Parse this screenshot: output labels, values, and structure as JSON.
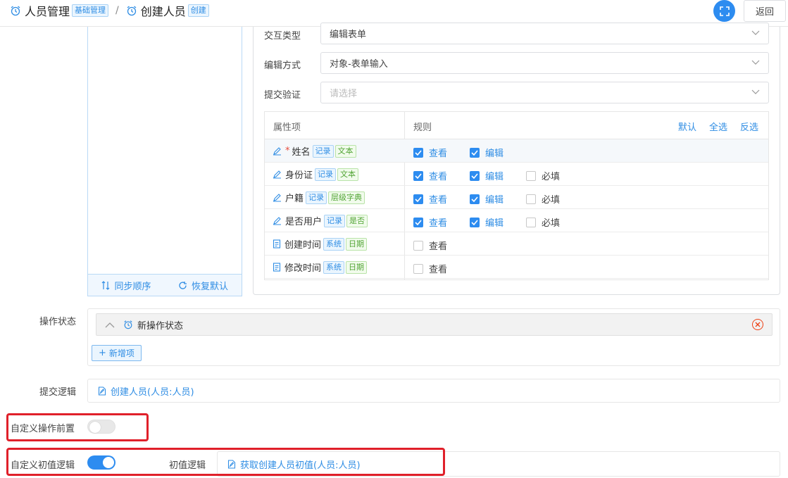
{
  "header": {
    "crumb1_title": "人员管理",
    "crumb1_badge": "基础管理",
    "separator": "/",
    "crumb2_title": "创建人员",
    "crumb2_badge": "创建",
    "back_label": "返回"
  },
  "left_panel": {
    "sync_label": "同步顺序",
    "reset_label": "恢复默认"
  },
  "config": {
    "interaction_label": "交互类型",
    "interaction_value": "编辑表单",
    "edit_mode_label": "编辑方式",
    "edit_mode_value": "对象-表单输入",
    "submit_validate_label": "提交验证",
    "submit_validate_placeholder": "请选择"
  },
  "prop_table": {
    "col_property": "属性项",
    "col_rule": "规则",
    "actions": [
      "默认",
      "全选",
      "反选"
    ],
    "rows": [
      {
        "name": "姓名",
        "required": "*",
        "tag1": "记录",
        "tag2": "文本",
        "view": "查看",
        "edit": "编辑"
      },
      {
        "name": "身份证",
        "tag1": "记录",
        "tag2": "文本",
        "view": "查看",
        "edit": "编辑",
        "must": "必填"
      },
      {
        "name": "户籍",
        "tag1": "记录",
        "tag2": "层级字典",
        "view": "查看",
        "edit": "编辑",
        "must": "必填"
      },
      {
        "name": "是否用户",
        "tag1": "记录",
        "tag2": "是否",
        "view": "查看",
        "edit": "编辑",
        "must": "必填"
      },
      {
        "name": "创建时间",
        "tag1": "系统",
        "tag2": "日期",
        "view": "查看"
      },
      {
        "name": "修改时间",
        "tag1": "系统",
        "tag2": "日期",
        "view": "查看"
      }
    ]
  },
  "form": {
    "op_state_label": "操作状态",
    "op_state_item": "新操作状态",
    "add_item_label": "新增项",
    "submit_logic_label": "提交逻辑",
    "submit_logic_value": "创建人员(人员:人员)",
    "custom_pre_label": "自定义操作前置",
    "custom_pre_enabled": false,
    "custom_init_label": "自定义初值逻辑",
    "custom_init_enabled": true,
    "init_logic_label": "初值逻辑",
    "init_logic_value": "获取创建人员初值(人员:人员)"
  },
  "colors": {
    "primary": "#2d8cf0",
    "highlight_box": "#e0202a",
    "tag_blue": "#2f8de4",
    "tag_green": "#52a535"
  }
}
